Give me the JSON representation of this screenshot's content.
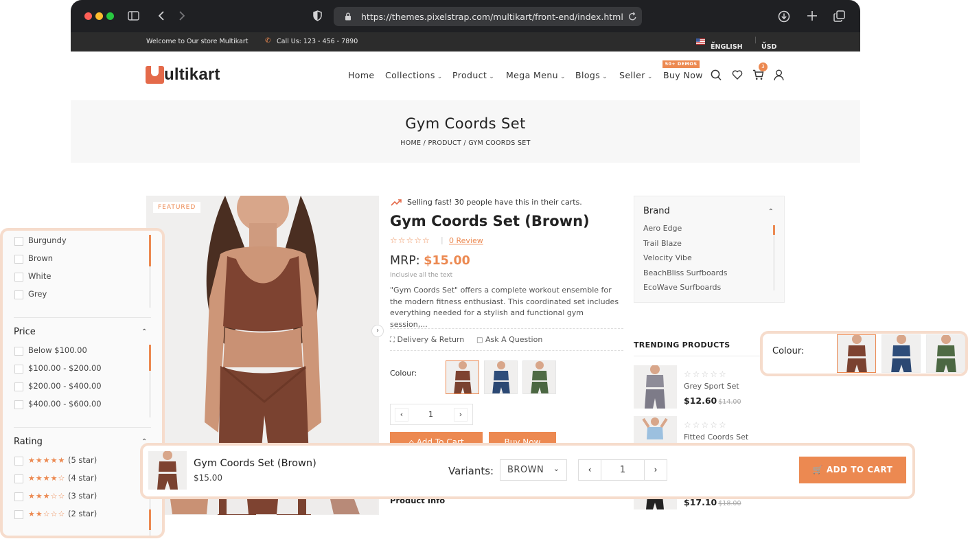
{
  "browser": {
    "url": "https://themes.pixelstrap.com/multikart/front-end/index.html"
  },
  "topbar": {
    "welcome": "Welcome to Our store Multikart",
    "call": "Call Us: 123 - 456 - 7890",
    "language": "ENGLISH",
    "currency": "USD"
  },
  "header": {
    "logo_text": "ultikart",
    "nav": [
      "Home",
      "Collections",
      "Product",
      "Mega Menu",
      "Blogs",
      "Seller",
      "Buy Now"
    ],
    "demo_badge": "50+ DEMOS",
    "cart_count": "3"
  },
  "breadcrumb": {
    "title": "Gym Coords Set",
    "path": "HOME  /  PRODUCT  /  GYM COORDS SET"
  },
  "product": {
    "featured_tag": "FEATURED",
    "selling_fast": "Selling fast! 30 people have this in their carts.",
    "title": "Gym Coords Set (Brown)",
    "stars": "☆☆☆☆☆",
    "review_link": "0 Review",
    "mrp_label": "MRP:",
    "price": "$15.00",
    "inclusive": "Inclusive all the text",
    "description": "\"Gym Coords Set\" offers a complete workout ensemble for the modern fitness enthusiast. This coordinated set includes everything needed for a stylish and functional gym session,...",
    "delivery_link": "Delivery & Return",
    "ask_link": "Ask A Question",
    "colour_label": "Colour:",
    "quantity": "1",
    "add_to_cart": "Add To Cart",
    "buy_now": "Buy Now",
    "product_info": "Product Info"
  },
  "brand_filter": {
    "title": "Brand",
    "items": [
      "Aero Edge",
      "Trail Blaze",
      "Velocity Vibe",
      "BeachBliss Surfboards",
      "EcoWave Surfboards"
    ]
  },
  "trending": {
    "title": "TRENDING PRODUCTS",
    "items": [
      {
        "name": "Grey Sport Set",
        "price": "$12.60",
        "old_price": "$14.00"
      },
      {
        "name": "Fitted Coords Set",
        "price": "",
        "old_price": ""
      },
      {
        "name": "",
        "price": "$17.10",
        "old_price": "$18.00"
      }
    ]
  },
  "left_filters": {
    "colors": [
      "Burgundy",
      "Brown",
      "White",
      "Grey"
    ],
    "price_title": "Price",
    "prices": [
      "Below $100.00",
      "$100.00 - $200.00",
      "$200.00 - $400.00",
      "$400.00 - $600.00"
    ],
    "rating_title": "Rating",
    "ratings": [
      {
        "stars": "★★★★★",
        "label": "(5 star)"
      },
      {
        "stars": "★★★★☆",
        "label": "(4 star)"
      },
      {
        "stars": "★★★☆☆",
        "label": "(3 star)"
      },
      {
        "stars": "★★☆☆☆",
        "label": "(2 star)"
      }
    ]
  },
  "colour_callout": {
    "label": "Colour:"
  },
  "sticky_cart": {
    "title": "Gym Coords Set (Brown)",
    "price": "$15.00",
    "variants_label": "Variants:",
    "variant_value": "BROWN",
    "quantity": "1",
    "add_button": "ADD TO CART"
  },
  "colors": {
    "accent": "#ec8951",
    "brown": "#8a4a34",
    "blue": "#2e4d7a",
    "green": "#4f6b45",
    "grey": "#8e8c98"
  }
}
